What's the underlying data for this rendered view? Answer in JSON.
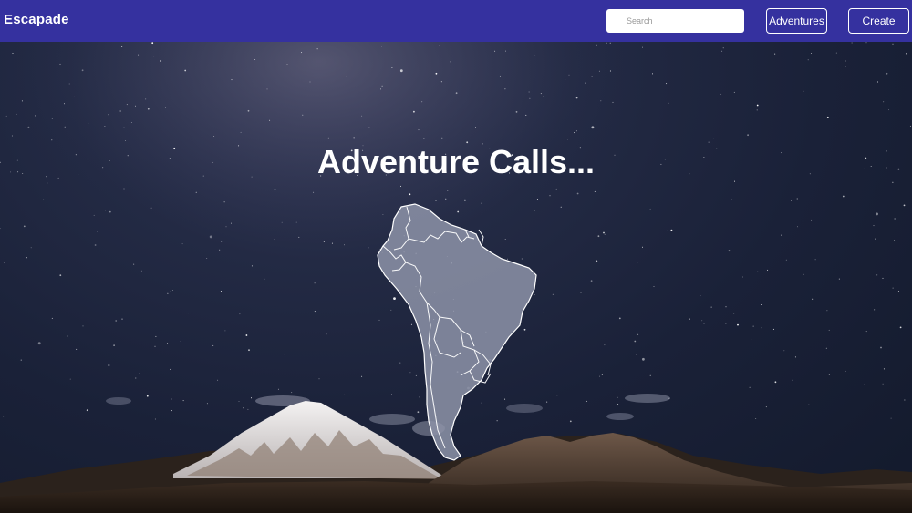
{
  "navbar": {
    "brand": "Escapade",
    "search_placeholder": "Search",
    "buttons": {
      "adventures": "Adventures",
      "create": "Create"
    },
    "background_color": "#35319f"
  },
  "hero": {
    "title": "Adventure Calls...",
    "map_region": "south-america-map",
    "background": "starry-night-mountains"
  }
}
